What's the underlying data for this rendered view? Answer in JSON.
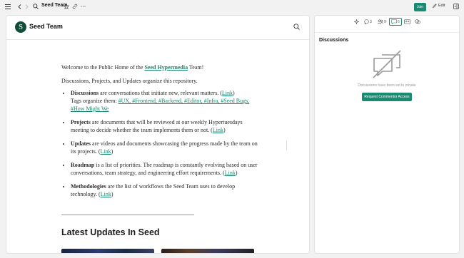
{
  "topbar": {
    "title": "Seed Team",
    "join_label": "Join",
    "edit_label": "Edit"
  },
  "site": {
    "name": "Seed Team",
    "logo_letter": "S"
  },
  "article": {
    "welcome_prefix": "Welcome to the Public Home of the ",
    "welcome_link": "Seed Hypermedia",
    "welcome_suffix": " Team!",
    "intro": "Discussions, Projects, and Updates organize this repository.",
    "link_text": "Link",
    "bullets": [
      {
        "term": "Discussions",
        "text": " are conversations that initiate new, relevant matters. (",
        "close": ")"
      },
      {
        "term": "Projects",
        "text": " are documents that will be reviewed at our weekly Hypertuesdays meeting to decide whether the team implements them or not. (",
        "close": ")"
      },
      {
        "term": "Updates",
        "text": " are videos and documents showcasing the progress made by the team on its projects. (",
        "close": ")"
      },
      {
        "term": "Roadmap",
        "text": " is a list of priorities. The roadmap is constantly evolving based on user conversations, team strategy, and engineering effort requirements. (",
        "close": ")"
      },
      {
        "term": "Methodologies",
        "text": " are the list of workflows the Seed Team uses to develop technology. (",
        "close": ")"
      }
    ],
    "tags_prefix": "Tags organize them: ",
    "tags": "#UX, #Frontend, #Backend, #Editor, #Infra, #Seed Bugs, #How Might We",
    "latest_heading": "Latest Updates In Seed"
  },
  "side": {
    "counts": {
      "comments": "3",
      "people": "9",
      "discussions": "6"
    },
    "discussions_title": "Discussions",
    "private_text": "Discussions have been set to private",
    "request_label": "Request Commentor Access"
  },
  "colors": {
    "accent": "#1a8a73",
    "link": "#17876b",
    "logo_bg": "#0f4d3a"
  },
  "icons": [
    "menu-icon",
    "back-icon",
    "forward-icon",
    "search-icon",
    "star-icon",
    "link-icon",
    "more-icon",
    "pencil-icon",
    "panel-icon",
    "sparkle-icon",
    "comment-icon",
    "people-icon",
    "discussion-icon",
    "collaborators-icon",
    "chat-icon",
    "comments-off-icon"
  ]
}
